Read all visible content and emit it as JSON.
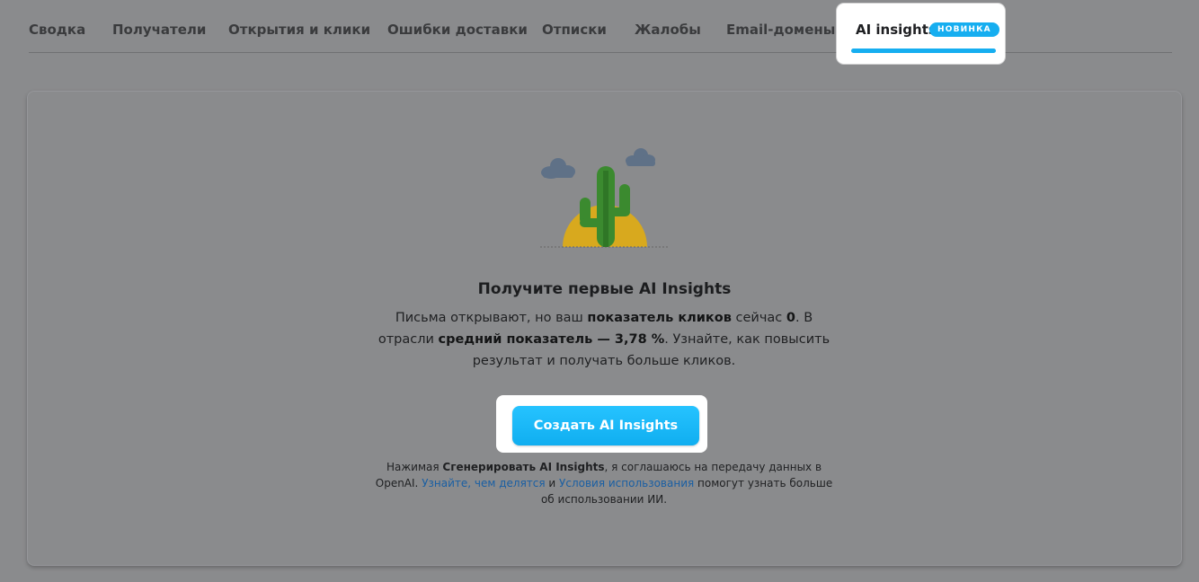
{
  "tabs": {
    "items": [
      {
        "label": "Сводка"
      },
      {
        "label": "Получатели"
      },
      {
        "label": "Открытия и клики"
      },
      {
        "label": "Ошибки доставки"
      },
      {
        "label": "Отписки"
      },
      {
        "label": "Жалобы"
      },
      {
        "label": "Email-домены"
      }
    ],
    "active": {
      "label": "AI insights",
      "badge": "НОВИНКА"
    },
    "accent_color": "#16aef0"
  },
  "empty_state": {
    "illustration_icon": "cactus-sun-clouds-illustration",
    "title": "Получите первые AI Insights",
    "description": {
      "part1": "Письма открывают, но ваш ",
      "bold1": "показатель кликов",
      "part2": " сейчас ",
      "bold2": "0",
      "part3": ". В отрасли ",
      "bold3": "средний показатель — 3,78 %",
      "part4": ". Узнайте, как повысить результат и получать больше кликов."
    },
    "cta_label": "Создать AI Insights",
    "consent": {
      "part1": "Нажимая ",
      "bold": "Сгенерировать AI Insights",
      "part2": ", я соглашаюсь на передачу данных в OpenAI. ",
      "link1": "Узнайте, чем делятся",
      "part3": " и ",
      "link2": "Условия использования",
      "part4": " помогут узнать больше об использовании ИИ."
    }
  }
}
